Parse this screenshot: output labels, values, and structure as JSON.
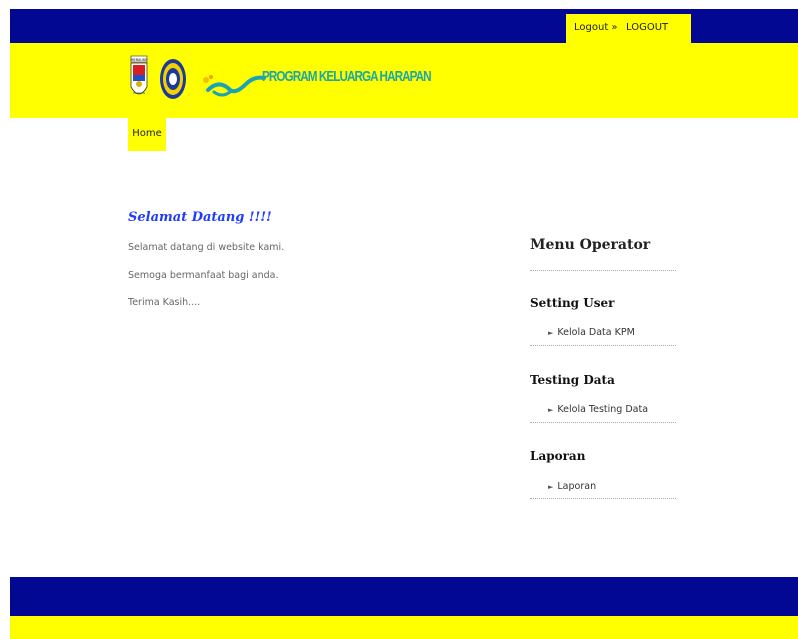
{
  "topbar": {
    "logout_link": "Logout »",
    "logout_label": "LOGOUT"
  },
  "header": {
    "brand": "PROGRAM KELUARGA HARAPAN",
    "seal_label": "MERAUKE"
  },
  "nav": {
    "home": "Home"
  },
  "welcome": {
    "title": "Selamat Datang !!!!",
    "lines": [
      "Selamat datang di website kami.",
      "Semoga bermanfaat bagi anda.",
      "Terima Kasih...."
    ]
  },
  "menu": {
    "title": "Menu Operator",
    "sections": [
      {
        "title": "Setting User",
        "link": "Kelola Data KPM"
      },
      {
        "title": "Testing Data",
        "link": "Kelola Testing Data"
      },
      {
        "title": "Laporan",
        "link": "Laporan"
      }
    ]
  },
  "colors": {
    "navy": "#020891",
    "yellow": "#ffff00",
    "brand_teal": "#19a7a8",
    "welcome_blue": "#1e3bff"
  }
}
